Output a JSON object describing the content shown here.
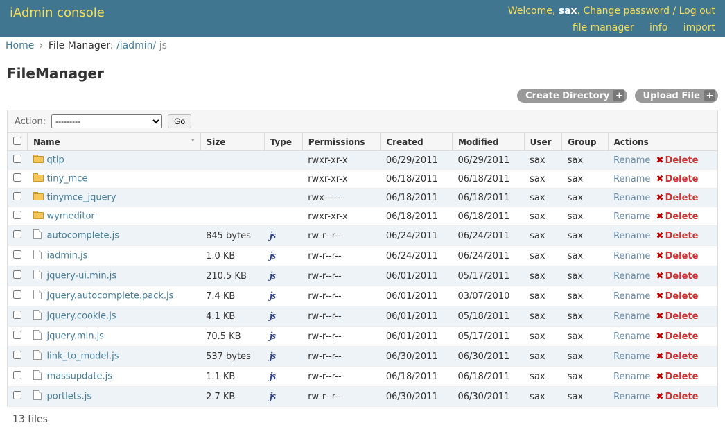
{
  "header": {
    "title": "iAdmin console",
    "welcome_prefix": "Welcome, ",
    "username": "sax",
    "welcome_suffix": ". ",
    "change_password": "Change password",
    "logout": "Log out",
    "nav": {
      "file_manager": "file manager",
      "info": "info",
      "import": "import"
    }
  },
  "breadcrumb": {
    "home": "Home",
    "file_manager_label": "File Manager: ",
    "path_parent": "/iadmin/",
    "current": "js"
  },
  "page_title": "FileManager",
  "buttons": {
    "create_dir": "Create Directory",
    "upload_file": "Upload File"
  },
  "actionbar": {
    "label": "Action:",
    "placeholder": "---------",
    "go": "Go"
  },
  "columns": {
    "name": "Name",
    "size": "Size",
    "type": "Type",
    "permissions": "Permissions",
    "created": "Created",
    "modified": "Modified",
    "user": "User",
    "group": "Group",
    "actions": "Actions"
  },
  "action_labels": {
    "rename": "Rename",
    "delete": "Delete"
  },
  "rows": [
    {
      "name": "qtip",
      "kind": "dir",
      "size": "",
      "perm": "rwxr-xr-x",
      "created": "06/29/2011",
      "modified": "06/29/2011",
      "user": "sax",
      "group": "sax"
    },
    {
      "name": "tiny_mce",
      "kind": "dir",
      "size": "",
      "perm": "rwxr-xr-x",
      "created": "06/18/2011",
      "modified": "06/18/2011",
      "user": "sax",
      "group": "sax"
    },
    {
      "name": "tinymce_jquery",
      "kind": "dir",
      "size": "",
      "perm": "rwx------",
      "created": "06/18/2011",
      "modified": "06/18/2011",
      "user": "sax",
      "group": "sax"
    },
    {
      "name": "wymeditor",
      "kind": "dir",
      "size": "",
      "perm": "rwxr-xr-x",
      "created": "06/18/2011",
      "modified": "06/18/2011",
      "user": "sax",
      "group": "sax"
    },
    {
      "name": "autocomplete.js",
      "kind": "js",
      "size": "845 bytes",
      "perm": "rw-r--r--",
      "created": "06/24/2011",
      "modified": "06/24/2011",
      "user": "sax",
      "group": "sax"
    },
    {
      "name": "iadmin.js",
      "kind": "js",
      "size": "1.0 KB",
      "perm": "rw-r--r--",
      "created": "06/24/2011",
      "modified": "06/24/2011",
      "user": "sax",
      "group": "sax"
    },
    {
      "name": "jquery-ui.min.js",
      "kind": "js",
      "size": "210.5 KB",
      "perm": "rw-r--r--",
      "created": "06/01/2011",
      "modified": "05/17/2011",
      "user": "sax",
      "group": "sax"
    },
    {
      "name": "jquery.autocomplete.pack.js",
      "kind": "js",
      "size": "7.4 KB",
      "perm": "rw-r--r--",
      "created": "06/01/2011",
      "modified": "03/07/2010",
      "user": "sax",
      "group": "sax"
    },
    {
      "name": "jquery.cookie.js",
      "kind": "js",
      "size": "4.1 KB",
      "perm": "rw-r--r--",
      "created": "06/01/2011",
      "modified": "05/18/2011",
      "user": "sax",
      "group": "sax"
    },
    {
      "name": "jquery.min.js",
      "kind": "js",
      "size": "70.5 KB",
      "perm": "rw-r--r--",
      "created": "06/01/2011",
      "modified": "05/17/2011",
      "user": "sax",
      "group": "sax"
    },
    {
      "name": "link_to_model.js",
      "kind": "js",
      "size": "537 bytes",
      "perm": "rw-r--r--",
      "created": "06/30/2011",
      "modified": "06/30/2011",
      "user": "sax",
      "group": "sax"
    },
    {
      "name": "massupdate.js",
      "kind": "js",
      "size": "1.1 KB",
      "perm": "rw-r--r--",
      "created": "06/18/2011",
      "modified": "06/18/2011",
      "user": "sax",
      "group": "sax"
    },
    {
      "name": "portlets.js",
      "kind": "js",
      "size": "2.7 KB",
      "perm": "rw-r--r--",
      "created": "06/30/2011",
      "modified": "06/30/2011",
      "user": "sax",
      "group": "sax"
    }
  ],
  "summary": "13 files"
}
